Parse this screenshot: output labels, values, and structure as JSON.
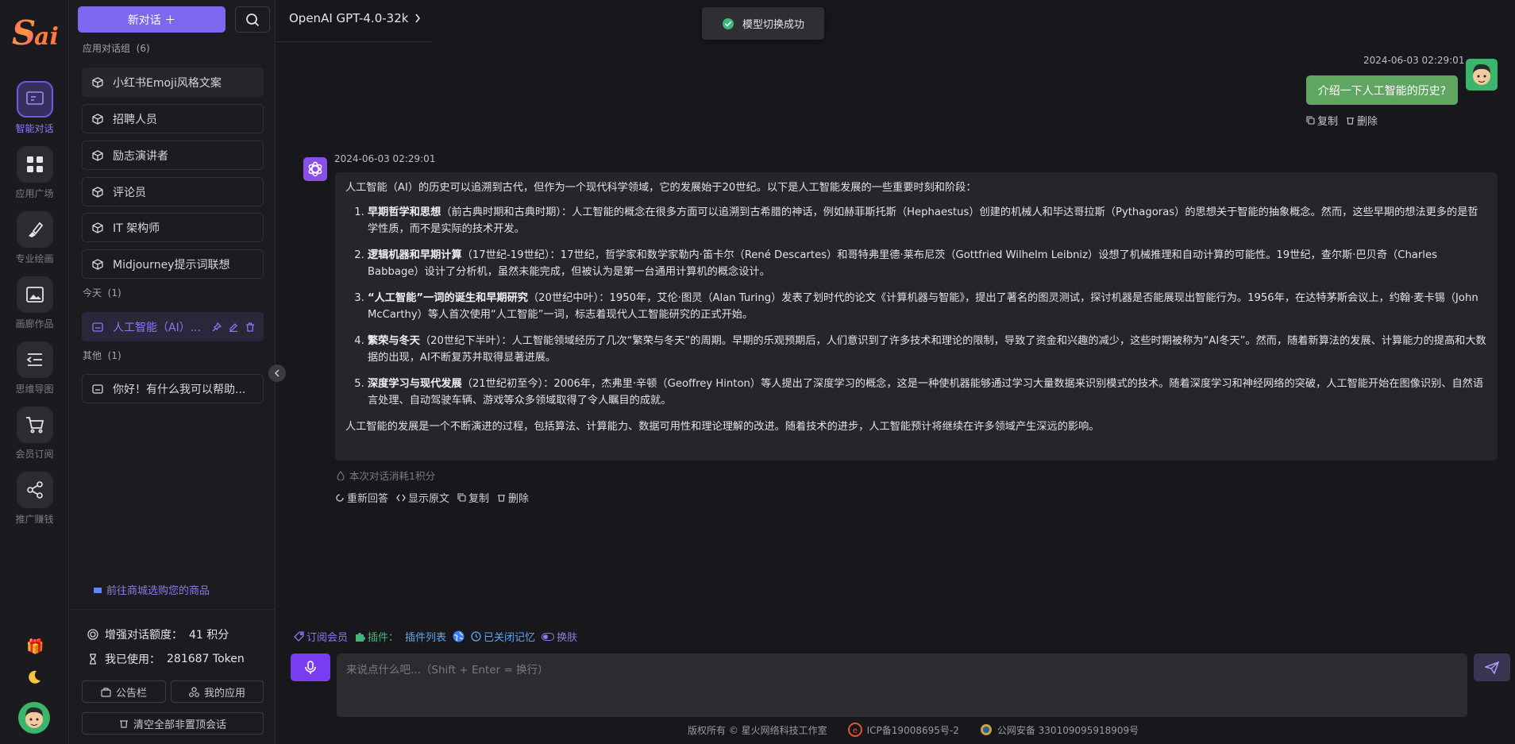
{
  "rail": {
    "items": [
      {
        "label": "智能对话",
        "icon": "chat-icon"
      },
      {
        "label": "应用广场",
        "icon": "apps-grid-icon"
      },
      {
        "label": "专业绘画",
        "icon": "brush-icon"
      },
      {
        "label": "画廊作品",
        "icon": "gallery-icon"
      },
      {
        "label": "思维导图",
        "icon": "mindmap-icon"
      },
      {
        "label": "会员订阅",
        "icon": "cart-icon"
      },
      {
        "label": "推广赚钱",
        "icon": "share-icon"
      }
    ]
  },
  "sidebar": {
    "new_chat_label": "新对话 ＋",
    "app_group_title": "应用对话组",
    "app_group_count": "(6)",
    "app_items": [
      "小红书Emoji风格文案",
      "招聘人员",
      "励志演讲者",
      "评论员",
      "IT 架构师",
      "Midjourney提示词联想"
    ],
    "today_title": "今天",
    "today_count": "(1)",
    "today_items": [
      "人工智能（AI）..."
    ],
    "other_title": "其他",
    "other_count": "(1)",
    "other_items": [
      "你好！有什么我可以帮助..."
    ],
    "shop_link": "前往商城选购您的商品",
    "quota_label": "增强对话额度：",
    "quota_value": "41 积分",
    "used_label": "我已使用：",
    "used_value": "281687 Token",
    "notice_btn": "公告栏",
    "myapps_btn": "我的应用",
    "clear_btn": "清空全部非置顶会话"
  },
  "header": {
    "model": "OpenAI GPT-4.0-32k"
  },
  "toast": {
    "text": "模型切换成功"
  },
  "user_msg": {
    "time": "2024-06-03 02:29:01",
    "text": "介绍一下人工智能的历史?",
    "copy": "复制",
    "delete": "删除"
  },
  "ai_msg": {
    "time": "2024-06-03 02:29:01",
    "intro": "人工智能（AI）的历史可以追溯到古代，但作为一个现代科学领域，它的发展始于20世纪。以下是人工智能发展的一些重要时刻和阶段：",
    "items": [
      {
        "title": "早期哲学和思想",
        "text": "（前古典时期和古典时期）：人工智能的概念在很多方面可以追溯到古希腊的神话，例如赫菲斯托斯（Hephaestus）创建的机械人和毕达哥拉斯（Pythagoras）的思想关于智能的抽象概念。然而，这些早期的想法更多的是哲学性质，而不是实际的技术开发。"
      },
      {
        "title": "逻辑机器和早期计算",
        "text": "（17世纪-19世纪）：17世纪，哲学家和数学家勒内·笛卡尔（René Descartes）和哥特弗里德·莱布尼茨（Gottfried Wilhelm Leibniz）设想了机械推理和自动计算的可能性。19世纪，查尔斯·巴贝奇（Charles Babbage）设计了分析机，虽然未能完成，但被认为是第一台通用计算机的概念设计。"
      },
      {
        "title": "“人工智能”一词的诞生和早期研究",
        "text": "（20世纪中叶）：1950年，艾伦·图灵（Alan Turing）发表了划时代的论文《计算机器与智能》，提出了著名的图灵测试，探讨机器是否能展现出智能行为。1956年，在达特茅斯会议上，约翰·麦卡锡（John McCarthy）等人首次使用“人工智能”一词，标志着现代人工智能研究的正式开始。"
      },
      {
        "title": "繁荣与冬天",
        "text": "（20世纪下半叶）：人工智能领域经历了几次“繁荣与冬天”的周期。早期的乐观预期后，人们意识到了许多技术和理论的限制，导致了资金和兴趣的减少，这些时期被称为“AI冬天”。然而，随着新算法的发展、计算能力的提高和大数据的出现，AI不断复苏并取得显著进展。"
      },
      {
        "title": "深度学习与现代发展",
        "text": "（21世纪初至今）：2006年，杰弗里·辛顿（Geoffrey Hinton）等人提出了深度学习的概念，这是一种使机器能够通过学习大量数据来识别模式的技术。随着深度学习和神经网络的突破，人工智能开始在图像识别、自然语言处理、自动驾驶车辆、游戏等众多领域取得了令人瞩目的成就。"
      }
    ],
    "outro": "人工智能的发展是一个不断演进的过程，包括算法、计算能力、数据可用性和理论理解的改进。随着技术的进步，人工智能预计将继续在许多领域产生深远的影响。",
    "note": "本次对话消耗1积分",
    "regenerate": "重新回答",
    "show_raw": "显示原文",
    "copy": "复制",
    "delete": "删除"
  },
  "toolbar": {
    "subscribe": "订阅会员",
    "plugin_label": "插件：",
    "plugin_list": "插件列表",
    "memory": "已关闭记忆",
    "theme": "换肤"
  },
  "input": {
    "placeholder": "来说点什么吧...（Shift + Enter = 换行）"
  },
  "footer": {
    "copyright": "版权所有 © 星火网络科技工作室",
    "icp": "ICP备19008695号-2",
    "police": "公网安备 33010909591890​9号"
  },
  "colors": {
    "accent": "#7c68ee",
    "user_bubble": "#5fa760",
    "background": "#18181c"
  }
}
